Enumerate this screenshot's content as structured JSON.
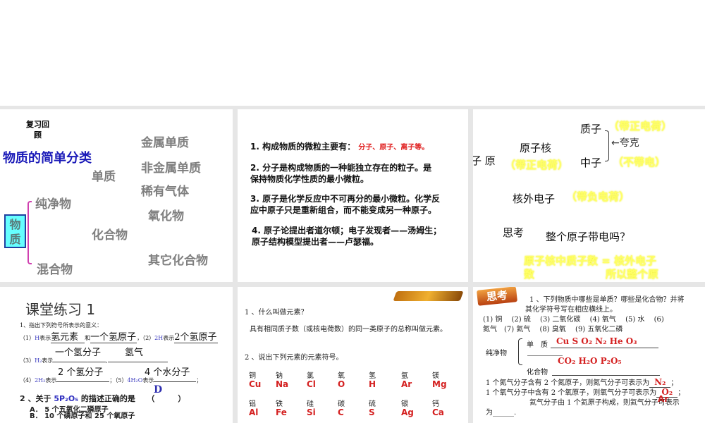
{
  "slide1": {
    "review": "复习回",
    "review2": "顾",
    "title": "物质的简单分类",
    "root": "物质",
    "pure": "纯净物",
    "mixture": "混合物",
    "simple": "单质",
    "compound": "化合物",
    "metal": "金属单质",
    "nonmetal": "非金属单质",
    "noble": "稀有气体",
    "oxide": "氧化物",
    "other": "其它化合物"
  },
  "slide2": {
    "p1": "1. 构成物质的微粒主要有：",
    "p1_answer": "分子、原子、离子等。",
    "p2a": "2. 分子是构成物质的一种能独立存在的粒子。是",
    "p2b": "保持物质化学性质的最小微粒。",
    "p3a": "3. 原子是化学反应中不可再分的最小微粒。化学反",
    "p3b": "应中原子只是重新组合，而不能变成另一种原子。",
    "p4a": "4. 原子论提出者道尔顿；电子发现者——汤姆生；",
    "p4b": "原子结构模型提出者——卢瑟福。"
  },
  "slide3": {
    "atom": "子 原",
    "nucleus": "原子核",
    "nucleus_charge": "（带正电荷）",
    "proton": "质子",
    "proton_charge": "（带正电荷）",
    "quark": "←夸克",
    "neutron": "中子",
    "neutron_charge": "（不带电）",
    "electron": "核外电子",
    "electron_charge": "（带负电荷）",
    "think": "思考",
    "question": "整个原子带电吗？",
    "answer1": "原子核中质子数 = 核外电子",
    "answer2a": "数",
    "answer2b": "所以整个原"
  },
  "slide4": {
    "title": "课堂练习 1",
    "q1": "1、指出下列符号所表示的意义：",
    "l1a": "（1）",
    "l1b": "H",
    "l1c": "表示",
    "l1d": "氢元素",
    "l1e": "和",
    "l1f": "一个氢原子",
    "l1g": "，（2）",
    "l1h": "2H",
    "l1i": "表示",
    "l1j": "2个氢原子",
    "l3a": "（3）",
    "l3b": "H₂",
    "l3c": "表示",
    "l3d": "一个氢分子",
    "l3e": "氢气",
    "l4a": "（4）",
    "l4b": "2H₂",
    "l4c": "表示",
    "l4d": "2 个氢分子",
    "l4e": "；（5）",
    "l4f": "4H₂O",
    "l4g": "表示",
    "l4h": "4 个水分子",
    "q2": "2 、关于",
    "q2f": "5P₂O₅",
    "q2b": "的描述正确的是",
    "q2p": "（　　　）",
    "q2ans": "D",
    "optA": "A．  5 个五氧化二磷原子",
    "optB": "B．  10 个磷原子和 25 个氧原子"
  },
  "slide5": {
    "q1": "1 、什么叫做元素？",
    "a1": "具有相同质子数（或核电荷数）的同一类原子的总称叫做元素。",
    "q2": "2 、说出下列元素的元素符号。",
    "row1": [
      {
        "n": "铜",
        "s": "Cu"
      },
      {
        "n": "钠",
        "s": "Na"
      },
      {
        "n": "氯",
        "s": "Cl"
      },
      {
        "n": "氧",
        "s": "O"
      },
      {
        "n": "氢",
        "s": "H"
      },
      {
        "n": "氩",
        "s": "Ar"
      },
      {
        "n": "镁",
        "s": "Mg"
      }
    ],
    "row2": [
      {
        "n": "铝",
        "s": "Al"
      },
      {
        "n": "铁",
        "s": "Fe"
      },
      {
        "n": "硅",
        "s": "Si"
      },
      {
        "n": "碳",
        "s": "C"
      },
      {
        "n": "硫",
        "s": "S"
      },
      {
        "n": "银",
        "s": "Ag"
      },
      {
        "n": "钙",
        "s": "Ca"
      }
    ]
  },
  "slide6": {
    "badge": "思考",
    "q1a": "1 、下列物质中哪些是单质？哪些是化合物？并将",
    "q1b": "其化学符号写在相应横线上。",
    "items1": "(1) 铜　 (2) 硫　 (3) 二氧化碳　 (4) 氧气　 (5) 水　 (6)",
    "items2": "氮气　(7) 氦气　 (8) 臭氧　 (9) 五氧化二磷",
    "pure": "纯净物",
    "simple": "单　质",
    "simple_ans": "Cu  S  O₂  N₂  He  O₃",
    "compound": "化合物",
    "compound_ans": "CO₂  H₂O  P₂O₅",
    "s1": "1 个氮气分子含有 2 个氮原子，则氮气分子可表示为",
    "s1ans": "N₂",
    "s2": "1 个氧气分子中含有 2 个氧原子，则氧气分子可表示为",
    "s2ans": "O₂",
    "s3": "氦气分子由 1 个氦原子构成，则氦气分子可表示",
    "s3ans": "Ar",
    "s4": "为______."
  }
}
